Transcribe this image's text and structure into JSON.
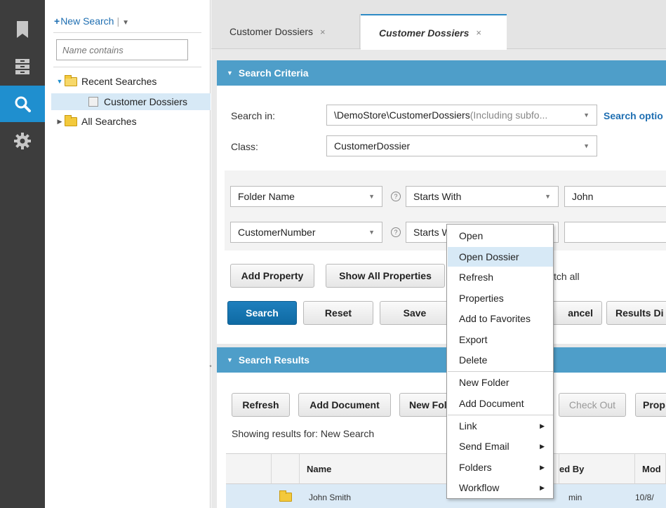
{
  "rail": {
    "items": [
      {
        "name": "bookmark-icon",
        "active": false
      },
      {
        "name": "browse-icon",
        "active": false
      },
      {
        "name": "search-icon",
        "active": true
      },
      {
        "name": "gear-icon",
        "active": false
      }
    ]
  },
  "tree": {
    "new_search_label": "New Search",
    "new_search_plus": "+",
    "name_filter_placeholder": "Name contains",
    "recent_searches": "Recent Searches",
    "customer_dossiers": "Customer Dossiers",
    "all_searches": "All Searches"
  },
  "tabs": [
    {
      "label": "Customer Dossiers",
      "close": "×"
    },
    {
      "label": "Customer Dossiers",
      "close": "×"
    }
  ],
  "criteria": {
    "title": "Search Criteria",
    "search_in_label": "Search in:",
    "search_in_value": "\\DemoStore\\CustomerDossiers",
    "search_in_hint": " (Including subfo...",
    "search_options": "Search optio",
    "class_label": "Class:",
    "class_value": "CustomerDossier",
    "row1": {
      "property": "Folder Name",
      "operator": "Starts With",
      "value": "John"
    },
    "row2": {
      "property": "CustomerNumber",
      "operator": "Starts W",
      "value": ""
    },
    "qmark": "?",
    "add_property": "Add Property",
    "show_all": "Show All Properties",
    "match_all": "tch all",
    "search": "Search",
    "reset": "Reset",
    "save": "Save",
    "cancel": "ancel",
    "results_display": "Results Di"
  },
  "results": {
    "title": "Search Results",
    "refresh": "Refresh",
    "add_document": "Add Document",
    "new_folder": "New Fol",
    "check_out": "Check Out",
    "properties": "Prop",
    "showing": "Showing results for:",
    "search_name": "New Search",
    "columns": {
      "name": "Name",
      "modified_by": "ed By",
      "modified_on": "Mod"
    },
    "rows": [
      {
        "name": "John Smith",
        "modified_by": "min",
        "modified_on": "10/8/"
      }
    ]
  },
  "context_menu": {
    "items": [
      "Open",
      "Open Dossier",
      "Refresh",
      "Properties",
      "Add to Favorites",
      "Export",
      "Delete",
      "New Folder",
      "Add Document",
      "Link",
      "Send Email",
      "Folders",
      "Workflow"
    ],
    "highlighted": "Open Dossier"
  }
}
